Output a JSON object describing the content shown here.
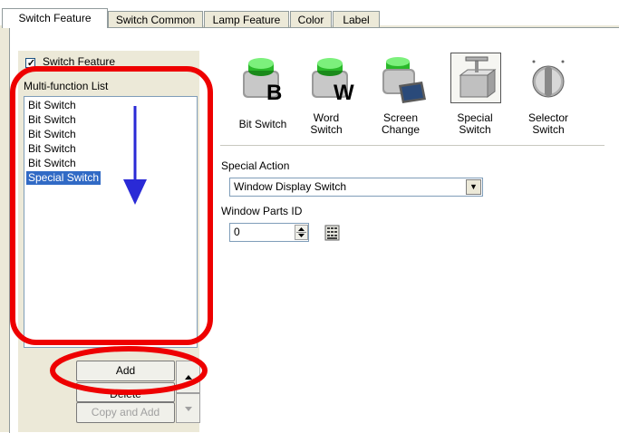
{
  "tabs": [
    {
      "label": "Switch Feature"
    },
    {
      "label": "Switch Common"
    },
    {
      "label": "Lamp Feature"
    },
    {
      "label": "Color"
    },
    {
      "label": "Label"
    }
  ],
  "switch_feature_checkbox": {
    "label": "Switch Feature",
    "checked": true
  },
  "multi_function_list": {
    "title": "Multi-function List",
    "items": [
      {
        "label": "Bit Switch"
      },
      {
        "label": "Bit Switch"
      },
      {
        "label": "Bit Switch"
      },
      {
        "label": "Bit Switch"
      },
      {
        "label": "Bit Switch"
      },
      {
        "label": "Special Switch",
        "selected": true
      }
    ]
  },
  "buttons": {
    "add": "Add",
    "delete": "Delete",
    "copy_and_add": "Copy and Add"
  },
  "switch_types": [
    {
      "label": "Bit Switch",
      "icon": "bit-switch-icon"
    },
    {
      "label": "Word\nSwitch",
      "icon": "word-switch-icon"
    },
    {
      "label": "Screen\nChange",
      "icon": "screen-change-icon"
    },
    {
      "label": "Special\nSwitch",
      "icon": "special-switch-icon",
      "selected": true
    },
    {
      "label": "Selector\nSwitch",
      "icon": "selector-switch-icon"
    }
  ],
  "special_action": {
    "label": "Special Action",
    "value": "Window Display Switch"
  },
  "window_parts_id": {
    "label": "Window Parts ID",
    "value": "0"
  },
  "annotation_colors": {
    "highlight": "#ee0000",
    "arrow": "#2a2ad6",
    "selection": "#316ac5"
  }
}
